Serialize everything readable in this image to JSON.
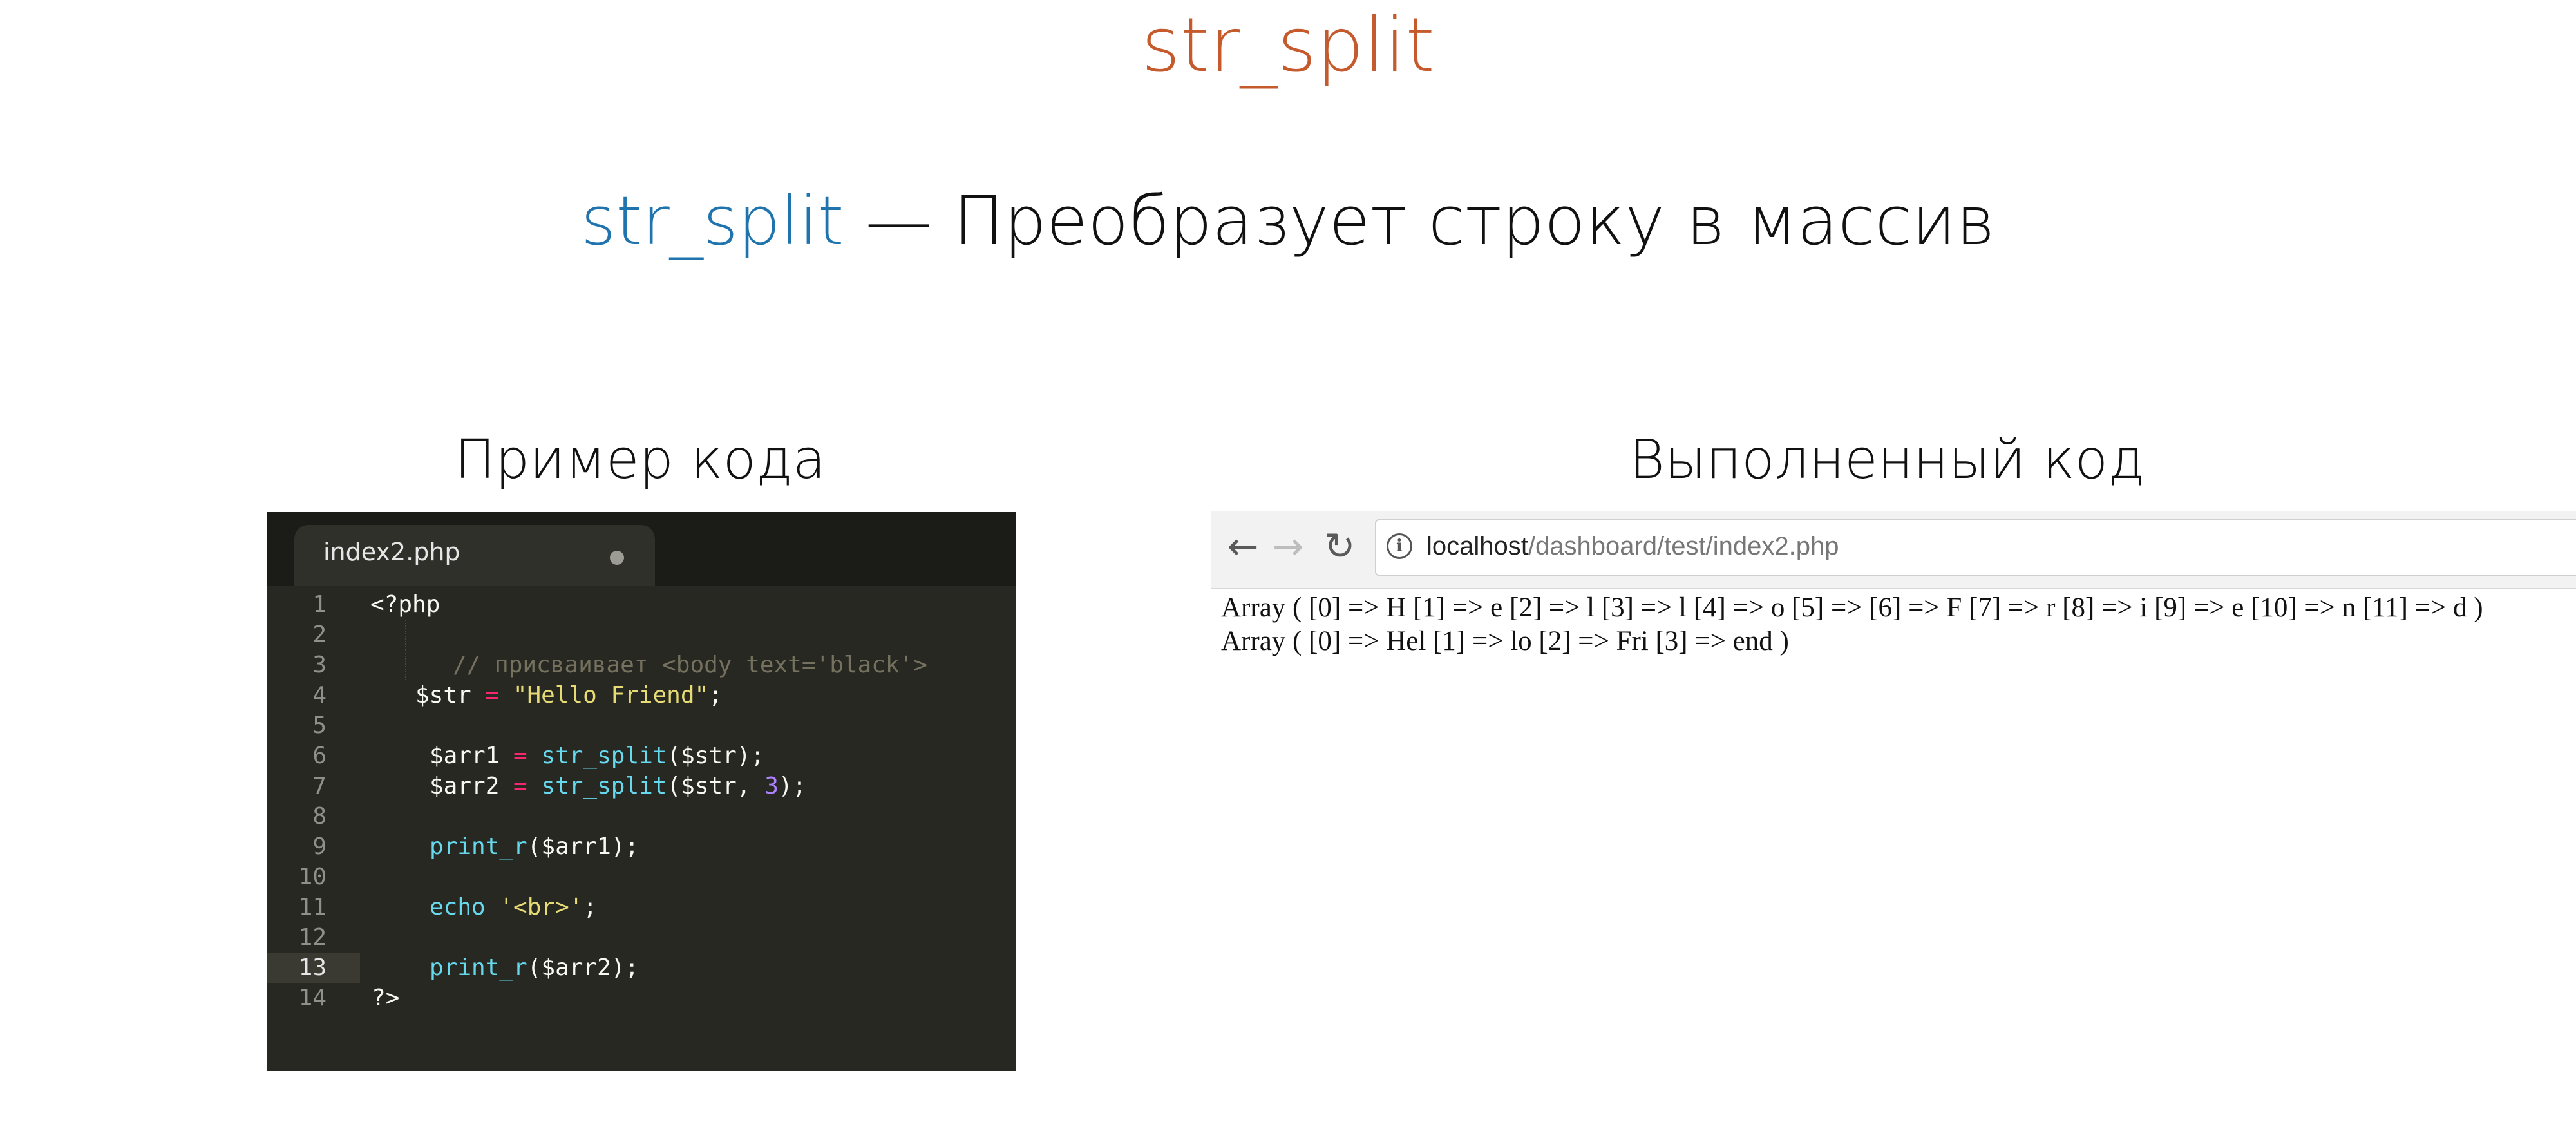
{
  "slide": {
    "title": "str_split",
    "subtitle_fn": "str_split",
    "subtitle_rest": " — Преобразует строку в массив",
    "caption_left": "Пример кода",
    "caption_right": "Выполненный код"
  },
  "editor": {
    "tab_name": "index2.php",
    "lines": [
      {
        "n": "1"
      },
      {
        "n": "2"
      },
      {
        "n": "3"
      },
      {
        "n": "4"
      },
      {
        "n": "5"
      },
      {
        "n": "6"
      },
      {
        "n": "7"
      },
      {
        "n": "8"
      },
      {
        "n": "9"
      },
      {
        "n": "10"
      },
      {
        "n": "11"
      },
      {
        "n": "12"
      },
      {
        "n": "13"
      },
      {
        "n": "14"
      }
    ],
    "code": {
      "l1": "<?php",
      "l3_comment": "// присваивает <body text='black'>",
      "l4_var": "$str",
      "l4_op": " = ",
      "l4_str": "\"Hello Friend\"",
      "l4_end": ";",
      "l6_var": "$arr1",
      "l6_op": " = ",
      "l6_fn": "str_split",
      "l6_args": "($str);",
      "l7_var": "$arr2",
      "l7_op": " = ",
      "l7_fn": "str_split",
      "l7_args": "($str, ",
      "l7_num": "3",
      "l7_end": ");",
      "l9_fn": "print_r",
      "l9_args": "($arr1);",
      "l11_fn": "echo",
      "l11_str": " '<br>'",
      "l11_end": ";",
      "l13_fn": "print_r",
      "l13_args": "($arr2);",
      "l14": "?>"
    },
    "colors": {
      "background": "#272822",
      "keyword": "#f92672",
      "string": "#e6db74",
      "function": "#66d9ef",
      "number": "#ae81ff",
      "comment": "#75715e"
    }
  },
  "browser": {
    "back_icon": "←",
    "forward_icon": "→",
    "reload_icon": "↻",
    "info_icon": "i",
    "url_host": "localhost",
    "url_path": "/dashboard/test/index2.php",
    "output_line1": "Array ( [0] => H [1] => e [2] => l [3] => l [4] => o [5] => [6] => F [7] => r [8] => i [9] => e [10] => n [11] => d )",
    "output_line2": "Array ( [0] => Hel [1] => lo [2] => Fri [3] => end )"
  }
}
